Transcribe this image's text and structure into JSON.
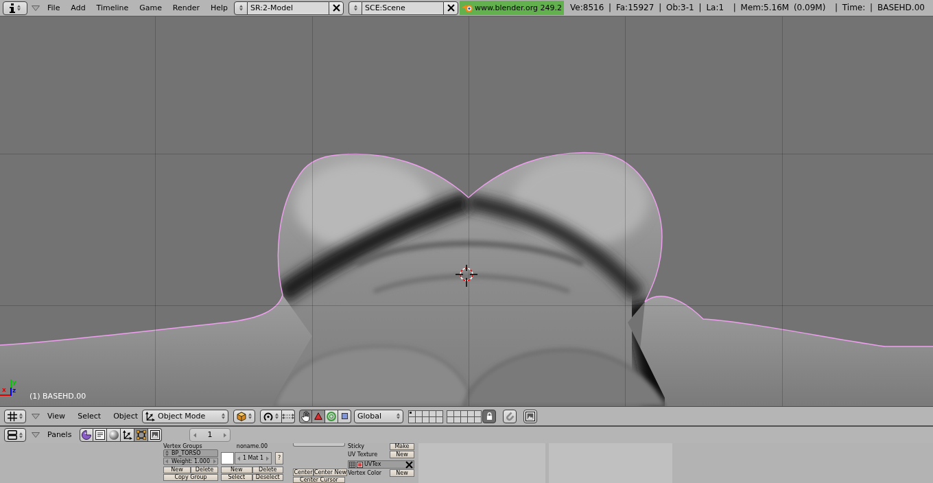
{
  "top_header": {
    "menus": [
      "File",
      "Add",
      "Timeline",
      "Game",
      "Render",
      "Help"
    ],
    "screen_selector": {
      "value": "SR:2-Model"
    },
    "scene_selector": {
      "value": "SCE:Scene"
    },
    "version": "www.blender.org 249.2",
    "stats": "Ve:8516 | Fa:15927 | Ob:3-1 | La:1  | Mem:5.16M (0.09M)  | Time: | BASEHD.00"
  },
  "viewport": {
    "axes": [
      {
        "label": "x",
        "color": "#e00000"
      },
      {
        "label": "y",
        "color": "#00c800"
      },
      {
        "label": "z",
        "color": "#0000f0"
      }
    ],
    "object_label": "(1) BASEHD.00"
  },
  "viewport_header": {
    "menus": [
      "View",
      "Select",
      "Object"
    ],
    "mode": {
      "value": "Object Mode"
    },
    "transform_tools": [
      {
        "kind": "hand",
        "selected": true
      },
      {
        "kind": "translate",
        "selected": true
      },
      {
        "kind": "rotate",
        "selected": false
      },
      {
        "kind": "scale",
        "selected": false
      }
    ],
    "orientation": {
      "value": "Global"
    },
    "layers": [
      {
        "used": true
      },
      {
        "used": false
      },
      {
        "used": false
      },
      {
        "used": false
      },
      {
        "used": false
      },
      {
        "used": false
      },
      {
        "used": false
      },
      {
        "used": false
      },
      {
        "used": false
      },
      {
        "used": false
      },
      {
        "used": false
      },
      {
        "used": false
      },
      {
        "used": false
      },
      {
        "used": false
      },
      {
        "used": false
      },
      {
        "used": false
      },
      {
        "used": false
      },
      {
        "used": false
      },
      {
        "used": false
      },
      {
        "used": false
      }
    ],
    "lock": {
      "on": true
    }
  },
  "buttons_header": {
    "menu": "Panels",
    "contexts": [
      {
        "kind": "logic",
        "selected": false
      },
      {
        "kind": "script",
        "selected": false
      },
      {
        "kind": "shading",
        "selected": false
      },
      {
        "kind": "object",
        "selected": false
      },
      {
        "kind": "editing",
        "selected": true
      },
      {
        "kind": "scene",
        "selected": false
      }
    ],
    "frame": {
      "value": "1"
    }
  },
  "panels": {
    "vertex_groups": {
      "title": "Vertex Groups",
      "group": {
        "value": "BP_TORSO"
      },
      "weight": {
        "value": "Weight: 1.000"
      },
      "buttons": [
        "New",
        "Delete",
        "Copy Group"
      ]
    },
    "materials": {
      "title": "noname.00",
      "material": {
        "value": "1 Mat 1"
      },
      "help": "?",
      "buttons": [
        "New",
        "Delete",
        "Select",
        "Deselect"
      ]
    },
    "center": {
      "buttons": [
        "Center",
        "Center New",
        "Center Cursor"
      ]
    },
    "mesh": {
      "rows": [
        {
          "kind": "action",
          "label": "Sticky",
          "button": "Make"
        },
        {
          "kind": "action",
          "label": "UV Texture",
          "button": "New"
        },
        {
          "kind": "layer",
          "name": "UVTex"
        },
        {
          "kind": "action",
          "label": "Vertex Color",
          "button": "New"
        }
      ]
    }
  }
}
